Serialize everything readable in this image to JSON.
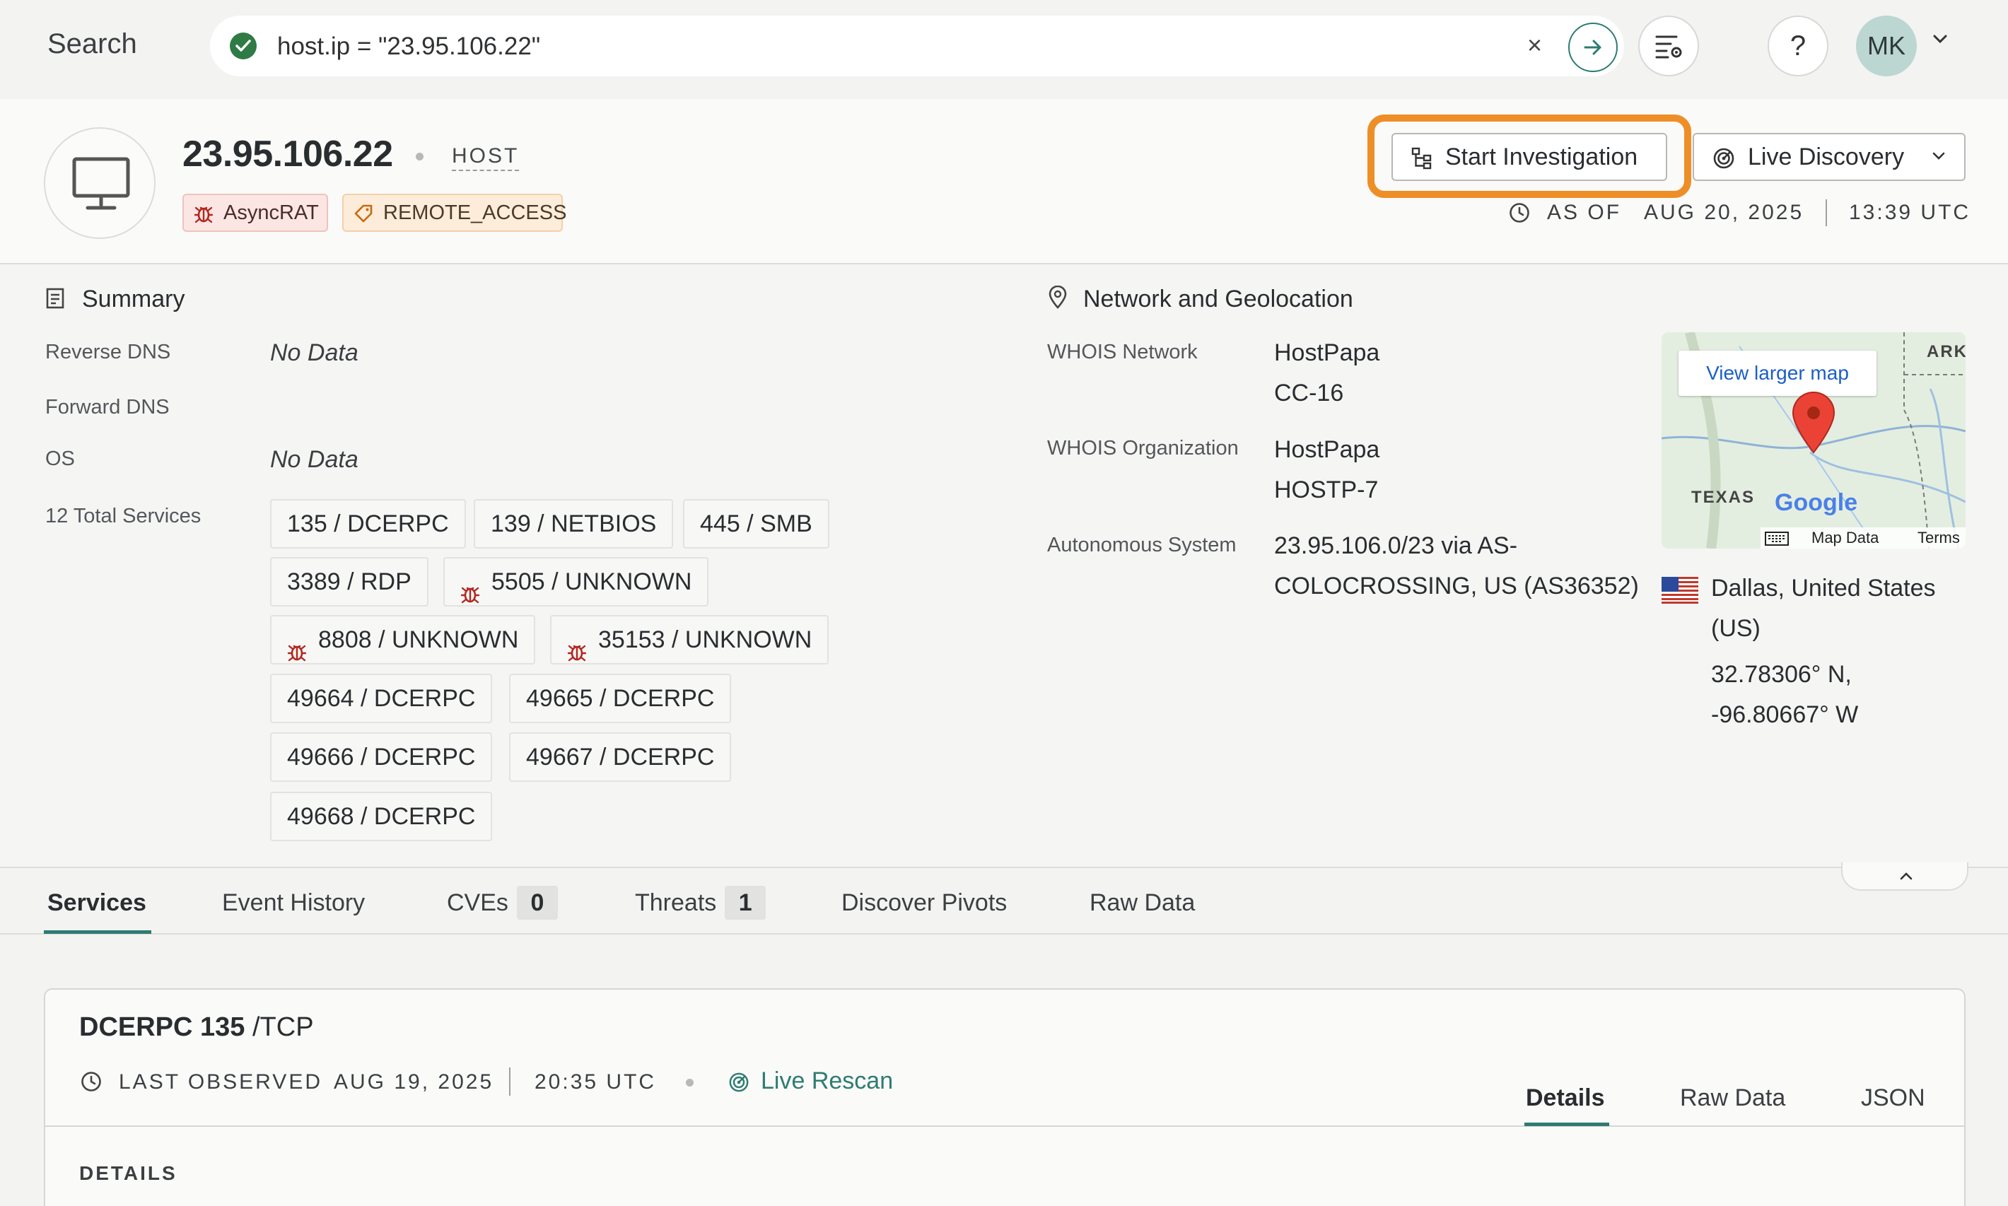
{
  "topbar": {
    "search_label": "Search",
    "query": "host.ip = \"23.95.106.22\"",
    "clear_symbol": "×",
    "help_symbol": "?",
    "avatar_initials": "MK"
  },
  "host": {
    "ip": "23.95.106.22",
    "type": "HOST",
    "tags": [
      {
        "label": "AsyncRAT",
        "icon": "bug-icon",
        "color": "#b3261e"
      },
      {
        "label": "REMOTE_ACCESS",
        "icon": "tag-icon",
        "color": "#c76a12"
      }
    ]
  },
  "actions": {
    "start_investigation": "Start Investigation",
    "live_discovery": "Live Discovery"
  },
  "as_of": {
    "label": "AS OF",
    "date": "AUG 20, 2025",
    "time": "13:39 UTC"
  },
  "summary": {
    "title": "Summary",
    "reverse_dns_label": "Reverse DNS",
    "reverse_dns_value": "No Data",
    "forward_dns_label": "Forward DNS",
    "os_label": "OS",
    "os_value": "No Data",
    "services_label": "12 Total Services",
    "services": [
      {
        "label": "135 / DCERPC",
        "threat": false
      },
      {
        "label": "139 / NETBIOS",
        "threat": false
      },
      {
        "label": "445 / SMB",
        "threat": false
      },
      {
        "label": "3389 / RDP",
        "threat": false
      },
      {
        "label": "5505 / UNKNOWN",
        "threat": true
      },
      {
        "label": "8808 / UNKNOWN",
        "threat": true
      },
      {
        "label": "35153 / UNKNOWN",
        "threat": true
      },
      {
        "label": "49664 / DCERPC",
        "threat": false
      },
      {
        "label": "49665 / DCERPC",
        "threat": false
      },
      {
        "label": "49666 / DCERPC",
        "threat": false
      },
      {
        "label": "49667 / DCERPC",
        "threat": false
      },
      {
        "label": "49668 / DCERPC",
        "threat": false
      }
    ]
  },
  "network": {
    "title": "Network and Geolocation",
    "whois_network_label": "WHOIS Network",
    "whois_network_value": [
      "HostPapa",
      "CC-16"
    ],
    "whois_org_label": "WHOIS Organization",
    "whois_org_value": [
      "HostPapa",
      "HOSTP-7"
    ],
    "as_label": "Autonomous System",
    "as_value": [
      "23.95.106.0/23 via AS-",
      "COLOCROSSING, US (AS36352)"
    ],
    "map": {
      "link": "View larger map",
      "label_texas": "TEXAS",
      "label_ark": "ARK",
      "google": "Google",
      "map_data": "Map Data",
      "terms": "Terms"
    },
    "location": [
      "Dallas, United States",
      "(US)"
    ],
    "coords": [
      "32.78306° N,",
      "-96.80667° W"
    ]
  },
  "tabs": [
    {
      "label": "Services",
      "active": true
    },
    {
      "label": "Event History"
    },
    {
      "label": "CVEs",
      "count": "0"
    },
    {
      "label": "Threats",
      "count": "1"
    },
    {
      "label": "Discover Pivots"
    },
    {
      "label": "Raw Data"
    }
  ],
  "service_card": {
    "name": "DCERPC 135",
    "transport": " /TCP",
    "last_observed_label": "LAST OBSERVED",
    "date": "AUG 19, 2025",
    "time": "20:35 UTC",
    "rescan": "Live Rescan",
    "tabs": [
      "Details",
      "Raw Data",
      "JSON"
    ],
    "details_heading": "DETAILS"
  },
  "colors": {
    "accent": "#2d7c72",
    "highlight": "#ee8e27",
    "threat": "#b3261e"
  }
}
